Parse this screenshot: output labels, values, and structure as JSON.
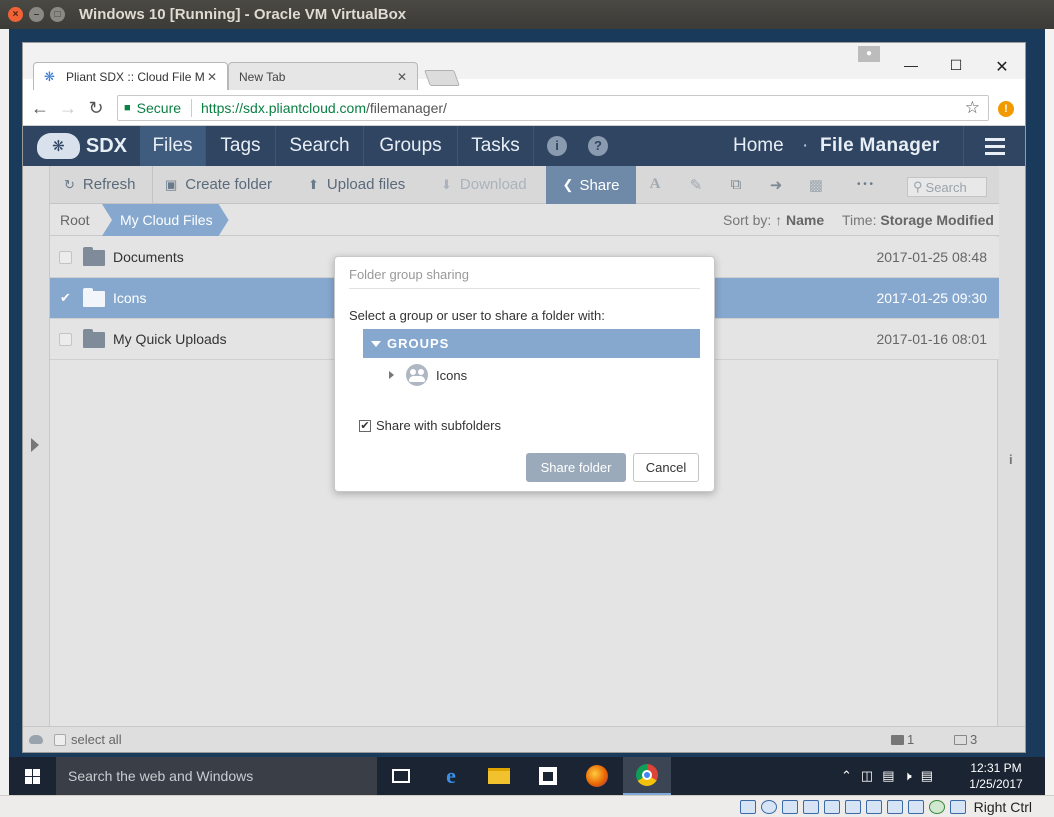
{
  "vbox": {
    "title": "Windows 10 [Running] - Oracle VM VirtualBox",
    "host_key": "Right Ctrl"
  },
  "browser": {
    "tabs": [
      {
        "title": "Pliant SDX :: Cloud File M",
        "active": true
      },
      {
        "title": "New Tab",
        "active": false
      }
    ],
    "secure_label": "Secure",
    "url_host": "https://sdx.pliantcloud.com",
    "url_path": "/filemanager/"
  },
  "app": {
    "logo_text": "SDX",
    "nav": [
      "Files",
      "Tags",
      "Search",
      "Groups",
      "Tasks"
    ],
    "home": "Home",
    "dot": "·",
    "file_manager": "File Manager",
    "actions": {
      "refresh": "Refresh",
      "create_folder": "Create folder",
      "upload": "Upload files",
      "download": "Download",
      "share": "Share",
      "more": "• • •",
      "search_placeholder": "Search"
    },
    "path": {
      "root": "Root",
      "current": "My Cloud Files"
    },
    "sort_prefix": "Sort by: ↑",
    "sort_value": "Name",
    "time_prefix": "Time:",
    "time_value": "Storage Modified",
    "files": [
      {
        "name": "Documents",
        "date": "2017-01-25 08:48",
        "selected": false
      },
      {
        "name": "Icons",
        "date": "2017-01-25 09:30",
        "selected": true
      },
      {
        "name": "My Quick Uploads",
        "date": "2017-01-16 08:01",
        "selected": false
      }
    ],
    "footer": {
      "select_all": "select all",
      "folders_selected": "1",
      "folders_total": "3"
    }
  },
  "dialog": {
    "title": "Folder group sharing",
    "prompt": "Select a group or user to share a folder with:",
    "groups_header": "GROUPS",
    "group_item": "Icons",
    "subfolders_label": "Share with subfolders",
    "subfolders_checked": true,
    "share_button": "Share folder",
    "cancel_button": "Cancel"
  },
  "taskbar": {
    "search_placeholder": "Search the web and Windows",
    "time": "12:31 PM",
    "date": "1/25/2017"
  },
  "colors": {
    "nav_bg": "#2f4562",
    "selection": "#86a8cf",
    "share_active": "#6e8aa8",
    "taskbar": "#1b2433"
  }
}
